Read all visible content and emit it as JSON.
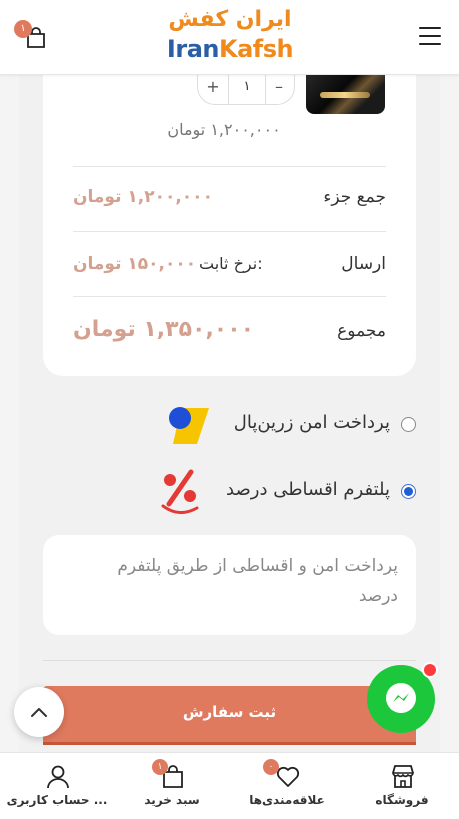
{
  "header": {
    "logo_fa": "ایران کفش",
    "logo_en_1": "Iran",
    "logo_en_2": "Kafsh",
    "cart_count": "۱"
  },
  "cart_item": {
    "quantity": "۱",
    "plus": "+",
    "minus": "–",
    "price": "۱,۲۰۰,۰۰۰ تومان"
  },
  "totals": {
    "subtotal_label": "جمع جزء",
    "subtotal_value": "۱,۲۰۰,۰۰۰ تومان",
    "shipping_label": "ارسال",
    "shipping_note": "نرخ ثابت:",
    "shipping_value": "۱۵۰,۰۰۰ تومان",
    "total_label": "مجموع",
    "total_value": "۱,۳۵۰,۰۰۰ تومان"
  },
  "payment": {
    "options": [
      {
        "label": "پرداخت امن زرین‌پال",
        "selected": false
      },
      {
        "label": "پلتفرم اقساطی درصد",
        "selected": true
      }
    ],
    "description": "پرداخت امن و اقساطی از طریق پلتفرم درصد"
  },
  "submit_label": "ثبت سفارش",
  "bottom_nav": {
    "shop": "فروشگاه",
    "wishlist": "علاقه‌مندی‌ها",
    "wishlist_count": "۰",
    "cart": "سبد خرید",
    "cart_count": "۱",
    "account": "حساب کاربری ..."
  },
  "colors": {
    "accent": "#e07a5f",
    "price": "#d4a08f",
    "messenger": "#1dc73b",
    "radio": "#1f5fd6"
  }
}
